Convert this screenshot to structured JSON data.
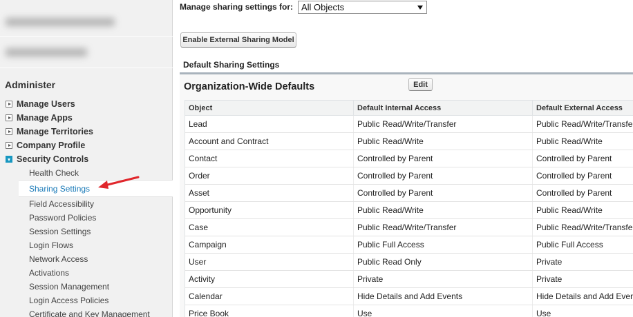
{
  "sidebar": {
    "section_title": "Administer",
    "nav": [
      {
        "label": "Manage Users",
        "expanded": false
      },
      {
        "label": "Manage Apps",
        "expanded": false
      },
      {
        "label": "Manage Territories",
        "expanded": false
      },
      {
        "label": "Company Profile",
        "expanded": false
      },
      {
        "label": "Security Controls",
        "expanded": true
      }
    ],
    "security_items": [
      {
        "label": "Health Check"
      },
      {
        "label": "Sharing Settings",
        "active": true
      },
      {
        "label": "Field Accessibility"
      },
      {
        "label": "Password Policies"
      },
      {
        "label": "Session Settings"
      },
      {
        "label": "Login Flows"
      },
      {
        "label": "Network Access"
      },
      {
        "label": "Activations"
      },
      {
        "label": "Session Management"
      },
      {
        "label": "Login Access Policies"
      },
      {
        "label": "Certificate and Key Management"
      }
    ]
  },
  "main": {
    "manage_label": "Manage sharing settings for:",
    "select_value": "All Objects",
    "external_button": "Enable External Sharing Model",
    "section_title": "Default Sharing Settings",
    "panel_title": "Organization-Wide Defaults",
    "edit_button": "Edit",
    "table": {
      "headers": [
        "Object",
        "Default Internal Access",
        "Default External Access"
      ],
      "rows": [
        [
          "Lead",
          "Public Read/Write/Transfer",
          "Public Read/Write/Transfer"
        ],
        [
          "Account and Contract",
          "Public Read/Write",
          "Public Read/Write"
        ],
        [
          "Contact",
          "Controlled by Parent",
          "Controlled by Parent"
        ],
        [
          "Order",
          "Controlled by Parent",
          "Controlled by Parent"
        ],
        [
          "Asset",
          "Controlled by Parent",
          "Controlled by Parent"
        ],
        [
          "Opportunity",
          "Public Read/Write",
          "Public Read/Write"
        ],
        [
          "Case",
          "Public Read/Write/Transfer",
          "Public Read/Write/Transfer"
        ],
        [
          "Campaign",
          "Public Full Access",
          "Public Full Access"
        ],
        [
          "User",
          "Public Read Only",
          "Private"
        ],
        [
          "Activity",
          "Private",
          "Private"
        ],
        [
          "Calendar",
          "Hide Details and Add Events",
          "Hide Details and Add Events"
        ],
        [
          "Price Book",
          "Use",
          "Use"
        ]
      ]
    }
  },
  "colors": {
    "accent": "#1797c0",
    "active_link": "#1a7ab8",
    "arrow": "#e0262b"
  }
}
